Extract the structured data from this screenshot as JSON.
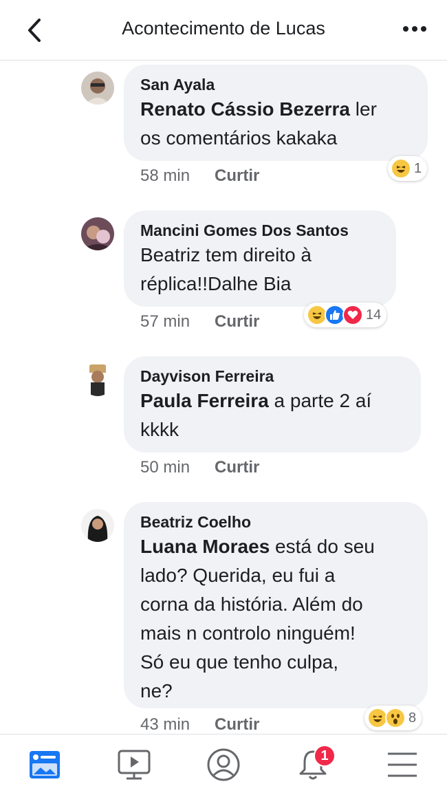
{
  "header": {
    "title": "Acontecimento de Lucas",
    "back_icon": "chevron-left-icon",
    "more_icon": "ellipsis-icon"
  },
  "comments": [
    {
      "author": "San Ayala",
      "mention": "Renato Cássio Bezerra",
      "text_line1_rest": " ler",
      "text_line2": "os comentários kakaka",
      "time": "58 min",
      "like_label": "Curtir",
      "reactions": [
        "haha"
      ],
      "reaction_count": "1"
    },
    {
      "author": "Mancini Gomes Dos Santos",
      "text_line1": "Beatriz tem direito à",
      "text_line2": "réplica!!Dalhe Bia",
      "time": "57 min",
      "like_label": "Curtir",
      "reactions": [
        "haha",
        "like",
        "love"
      ],
      "reaction_count": "14"
    },
    {
      "author": "Dayvison Ferreira",
      "mention": "Paula Ferreira",
      "text_line1_rest": " a parte 2 aí",
      "text_line2": "kkkk",
      "time": "50 min",
      "like_label": "Curtir"
    },
    {
      "author": "Beatriz Coelho",
      "mention": "Luana Moraes",
      "text_line1_rest": " está do seu",
      "text_line2": "lado? Querida, eu fui a",
      "text_line3": "corna da história. Além do",
      "text_line4": "mais n controlo ninguém!",
      "text_line5": "Só eu que tenho culpa,",
      "text_line6": "ne?",
      "time": "43 min",
      "like_label": "Curtir",
      "reactions": [
        "haha",
        "wow"
      ],
      "reaction_count": "8"
    }
  ],
  "bottom_nav": {
    "items": [
      "news-feed-icon",
      "watch-icon",
      "profile-icon",
      "notifications-icon",
      "menu-icon"
    ],
    "notification_count": "1"
  },
  "colors": {
    "bubble": "#f0f2f5",
    "accent": "#1877f2",
    "badge": "#f02849"
  }
}
